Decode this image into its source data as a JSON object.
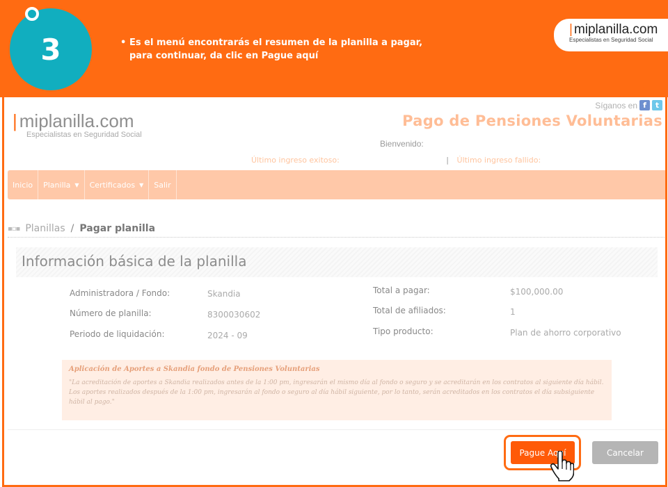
{
  "tutorial": {
    "step_number": "3",
    "bullet": "•",
    "text_line1": "Es el menú encontrarás el resumen de la planilla a pagar,",
    "text_line2": "para continuar, da clic en Pague aquí",
    "brand_name": "miplanilla.com",
    "brand_bar": "|",
    "brand_tagline": "Especialistas en Seguridad Social",
    "accent_color": "#ff6b12",
    "circle_color": "#11aebf"
  },
  "site": {
    "logo_bar": "|",
    "logo_name": "miplanilla.com",
    "logo_tagline": "Especialistas en Seguridad Social",
    "follow_label": "Síganos en",
    "facebook_glyph": "f",
    "twitter_glyph": "t",
    "title": "Pago de Pensiones Voluntarias",
    "welcome": "Bienvenido:",
    "last_success_label": "Último ingreso exitoso:",
    "separator": "|",
    "last_failed_label": "Último ingreso fallido:"
  },
  "nav": {
    "items": [
      "Inicio",
      "Planilla",
      "Certificados",
      "Salir"
    ],
    "caret": "▼"
  },
  "breadcrumb": {
    "parent": "Planillas",
    "separator": "/",
    "current": "Pagar planilla"
  },
  "section": {
    "title": "Información básica de la planilla"
  },
  "info": {
    "administradora_label": "Administradora / Fondo:",
    "administradora_value": "Skandia",
    "numero_label": "Número de planilla:",
    "numero_value": "8300030602",
    "periodo_label": "Periodo de liquidación:",
    "periodo_value": "2024 - 09",
    "total_label": "Total a pagar:",
    "total_value": "$100,000.00",
    "afiliados_label": "Total de afiliados:",
    "afiliados_value": "1",
    "producto_label": "Tipo producto:",
    "producto_value": "Plan de ahorro corporativo"
  },
  "notice": {
    "title": "Aplicación de Aportes a Skandia fondo de Pensiones Voluntarias",
    "body": "\"La acreditación de aportes a Skandia realizados antes de la 1:00 pm, ingresarán el mismo día al fondo o seguro y se acreditarán en los contratos al siguiente día hábil. Los aportes realizados después de la 1:00 pm, ingresarán al fondo o seguro al día hábil siguiente, por lo tanto, serán acreditados en los contratos el día subsiguiente hábil al pago.\""
  },
  "actions": {
    "pay_label": "Pague Aquí",
    "cancel_label": "Cancelar"
  }
}
